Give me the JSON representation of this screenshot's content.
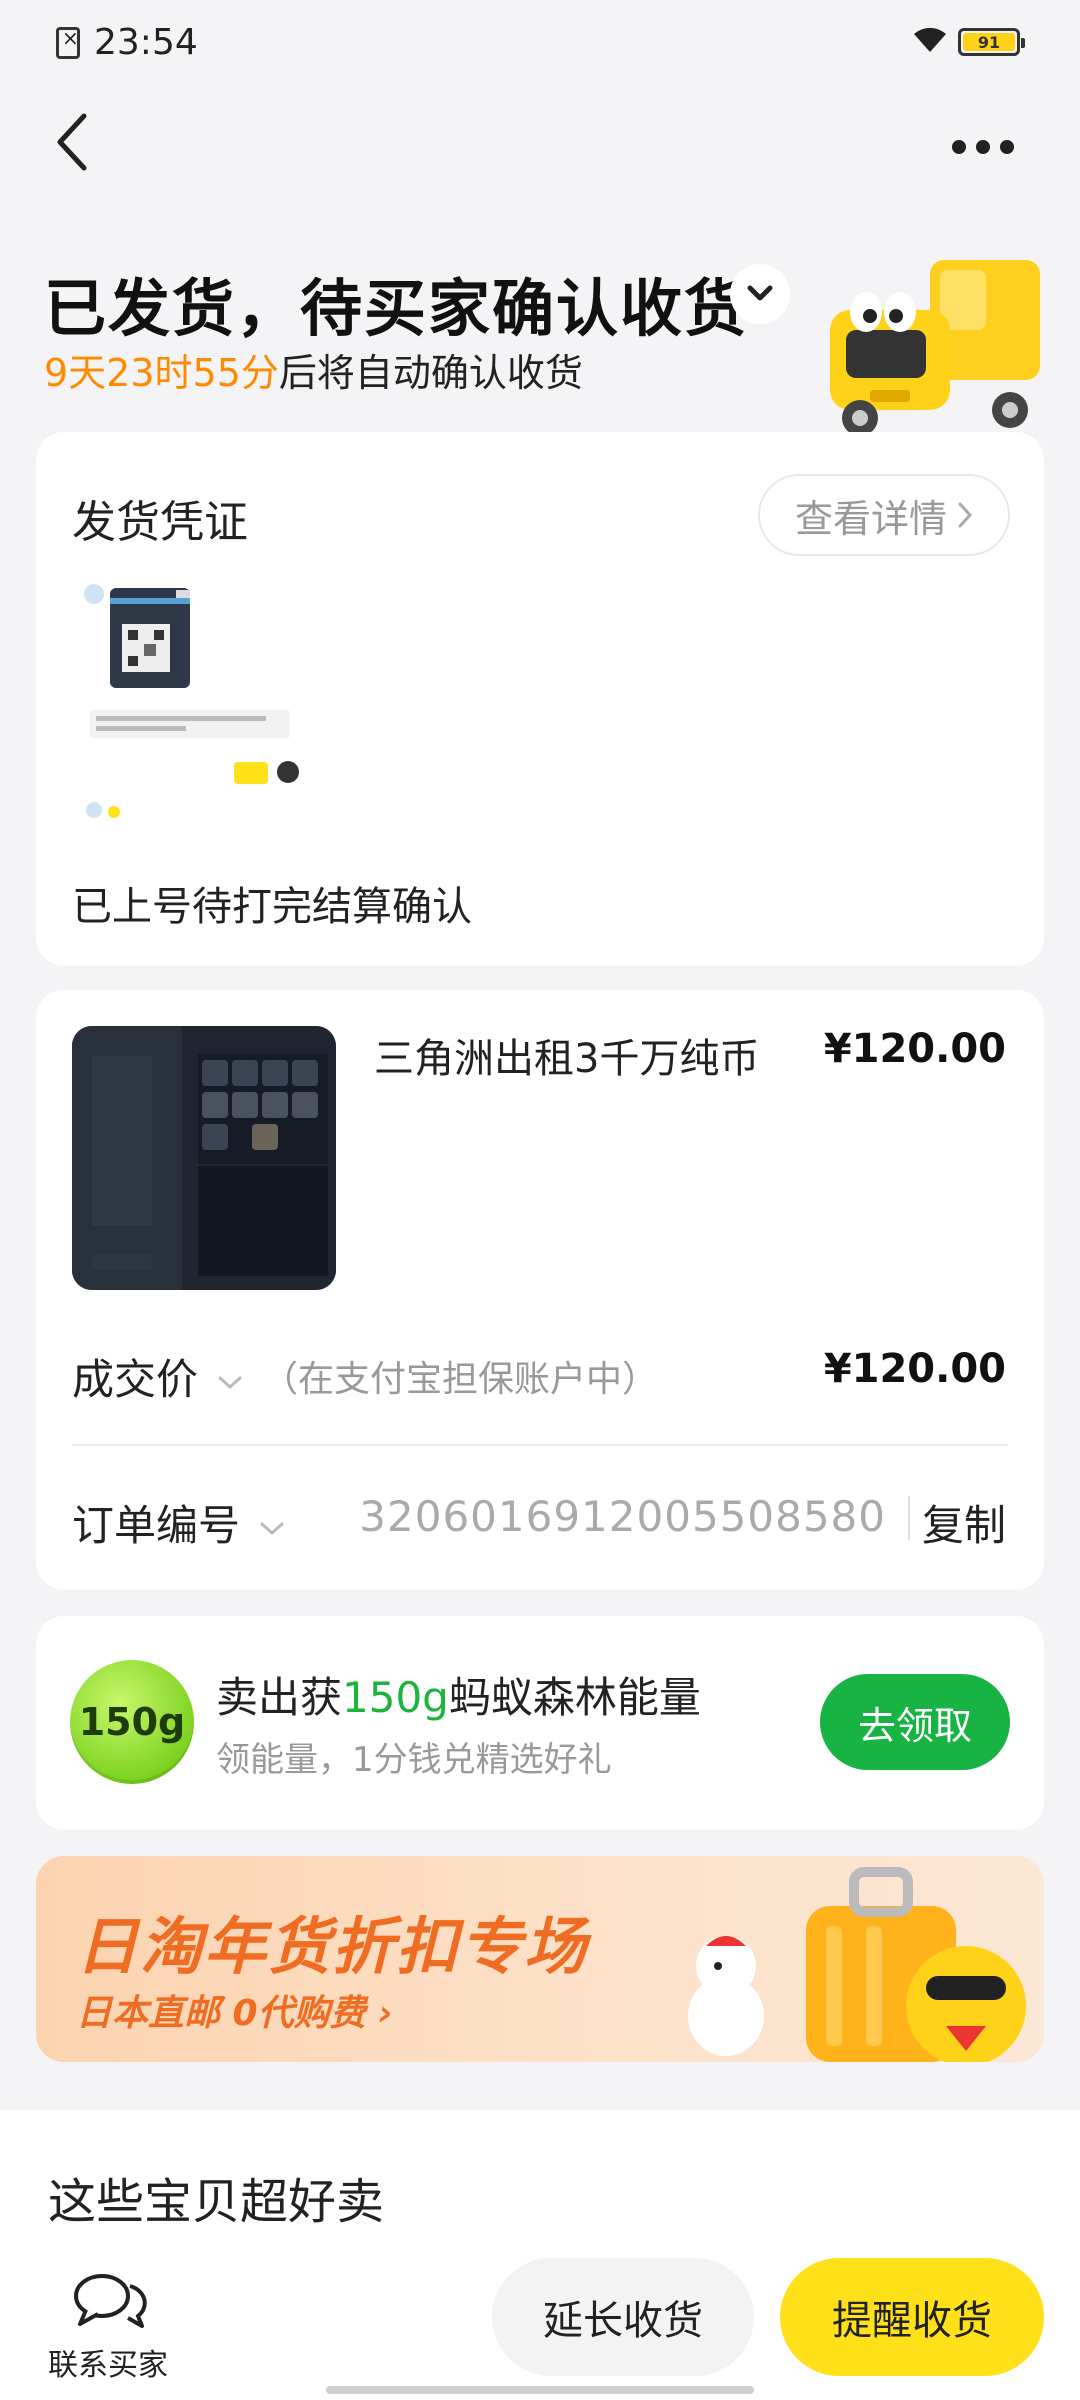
{
  "status_bar": {
    "time": "23:54",
    "battery": "91",
    "battery_color": "#ffd21a"
  },
  "header": {
    "back_icon": "chevron-left-icon",
    "more_icon": "more-dots-icon"
  },
  "order_status": {
    "title": "已发货，待买家确认收货",
    "countdown": "9天23时55分",
    "countdown_suffix": "后将自动确认收货",
    "highlight_color": "#ff8a00"
  },
  "voucher": {
    "title": "发货凭证",
    "detail_button": "查看详情",
    "caption": "已上号待打完结算确认"
  },
  "product": {
    "name": "三角洲出租3千万纯币",
    "price": "¥120.00",
    "deal_label": "成交价",
    "deal_note": "（在支付宝担保账户中）",
    "deal_price": "¥120.00",
    "order_label": "订单编号",
    "order_number": "3206016912005508580",
    "copy_label": "复制"
  },
  "energy": {
    "badge": "150g",
    "title_prefix": "卖出获",
    "title_amount": "150g",
    "title_suffix": "蚂蚁森林能量",
    "subtitle": "领能量，1分钱兑精选好礼",
    "claim_button": "去领取",
    "accent_color": "#17b343"
  },
  "banner": {
    "title": "日淘年货折扣专场",
    "subtitle": "日本直邮 0代购费 ›"
  },
  "recommend": {
    "title": "这些宝贝超好卖"
  },
  "bottom_bar": {
    "contact_label": "联系买家",
    "extend_button": "延长收货",
    "remind_button": "提醒收货",
    "remind_color": "#ffe11a"
  }
}
